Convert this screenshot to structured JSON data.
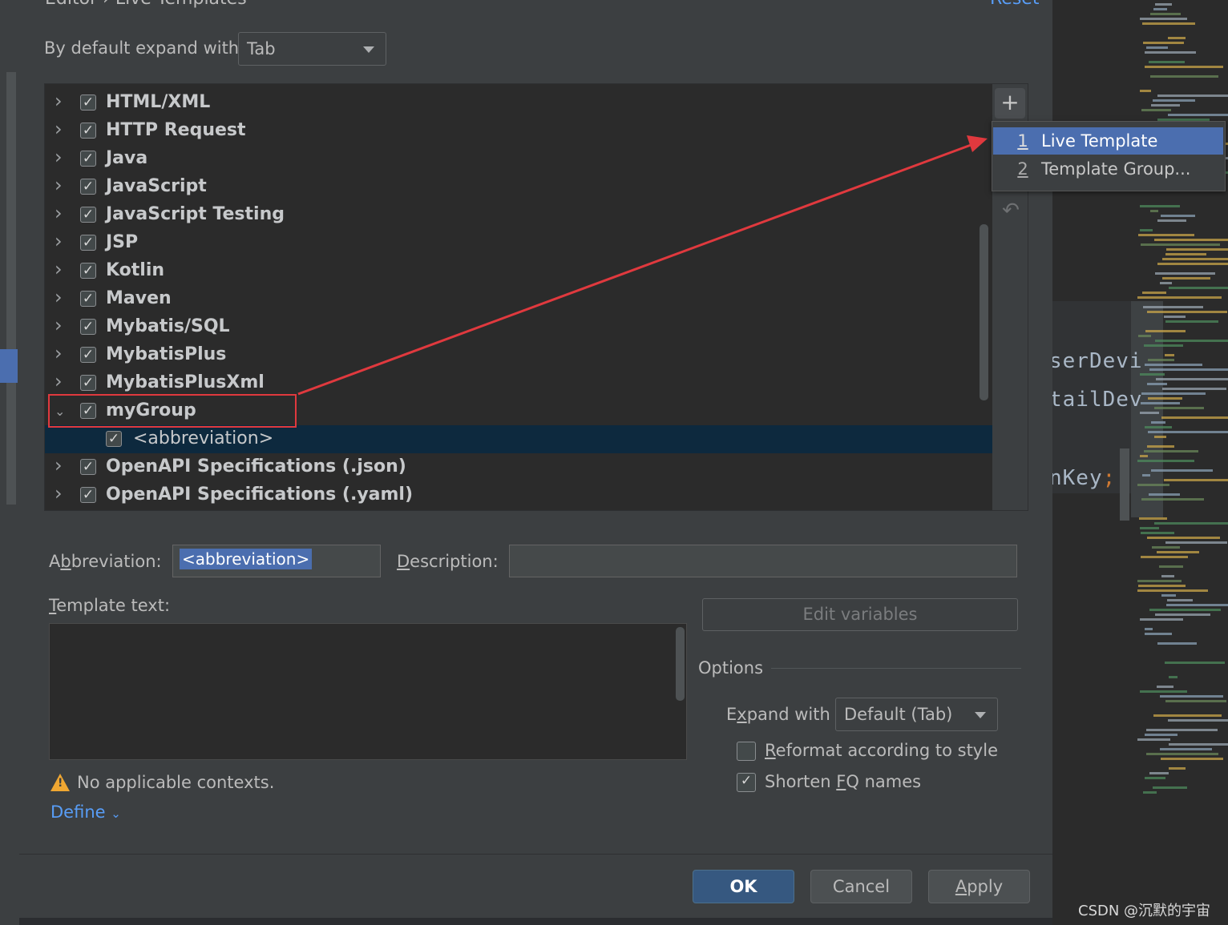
{
  "header": {
    "breadcrumb_cut": "Editor › Live Templates",
    "reset_link": "Reset"
  },
  "expand": {
    "label": "By default expand with",
    "value": "Tab"
  },
  "tree": {
    "groups": [
      {
        "label": "HTML/XML",
        "checked": true,
        "expanded": false
      },
      {
        "label": "HTTP Request",
        "checked": true,
        "expanded": false
      },
      {
        "label": "Java",
        "checked": true,
        "expanded": false
      },
      {
        "label": "JavaScript",
        "checked": true,
        "expanded": false
      },
      {
        "label": "JavaScript Testing",
        "checked": true,
        "expanded": false
      },
      {
        "label": "JSP",
        "checked": true,
        "expanded": false
      },
      {
        "label": "Kotlin",
        "checked": true,
        "expanded": false
      },
      {
        "label": "Maven",
        "checked": true,
        "expanded": false
      },
      {
        "label": "Mybatis/SQL",
        "checked": true,
        "expanded": false
      },
      {
        "label": "MybatisPlus",
        "checked": true,
        "expanded": false
      },
      {
        "label": "MybatisPlusXml",
        "checked": true,
        "expanded": false
      },
      {
        "label": "myGroup",
        "checked": true,
        "expanded": true
      },
      {
        "label": "<abbreviation>",
        "checked": true,
        "child": true,
        "selected": true
      },
      {
        "label": "OpenAPI Specifications (.json)",
        "checked": true,
        "expanded": false
      },
      {
        "label": "OpenAPI Specifications (.yaml)",
        "checked": true,
        "expanded": false
      }
    ]
  },
  "toolbar": {
    "add_symbol": "+",
    "undo_symbol": "↶"
  },
  "popup": {
    "items": [
      {
        "num": "1",
        "label": "Live Template",
        "active": true
      },
      {
        "num": "2",
        "label": "Template Group...",
        "active": false
      }
    ]
  },
  "form": {
    "abbr_label_pre": "A",
    "abbr_label_u": "b",
    "abbr_label_post": "breviation:",
    "abbr_value": "<abbreviation>",
    "desc_label_u": "D",
    "desc_label_post": "escription:",
    "desc_value": "",
    "template_label_u": "T",
    "template_label_post": "emplate text:",
    "template_value": "",
    "edit_vars": "Edit variables",
    "warning": "No applicable contexts.",
    "define_link": "Define"
  },
  "options": {
    "title": "Options",
    "expand_label_pre": "E",
    "expand_label_u": "x",
    "expand_label_post": "pand with",
    "expand_value": "Default (Tab)",
    "reformat_u": "R",
    "reformat_post": "eformat according to style",
    "reformat_checked": false,
    "shorten_pre": "Shorten ",
    "shorten_u": "F",
    "shorten_post": "Q names",
    "shorten_checked": true
  },
  "buttons": {
    "ok": "OK",
    "cancel": "Cancel",
    "apply_u": "A",
    "apply_post": "pply"
  },
  "editor": {
    "line1": "serDevi",
    "line2": "tailDev",
    "line3": "nKey",
    "line3_semi": ";"
  },
  "watermark": "CSDN @沉默的宇宙",
  "colors": {
    "accent": "#4b6eaf",
    "annotation": "#e0393e",
    "link": "#589df6"
  }
}
